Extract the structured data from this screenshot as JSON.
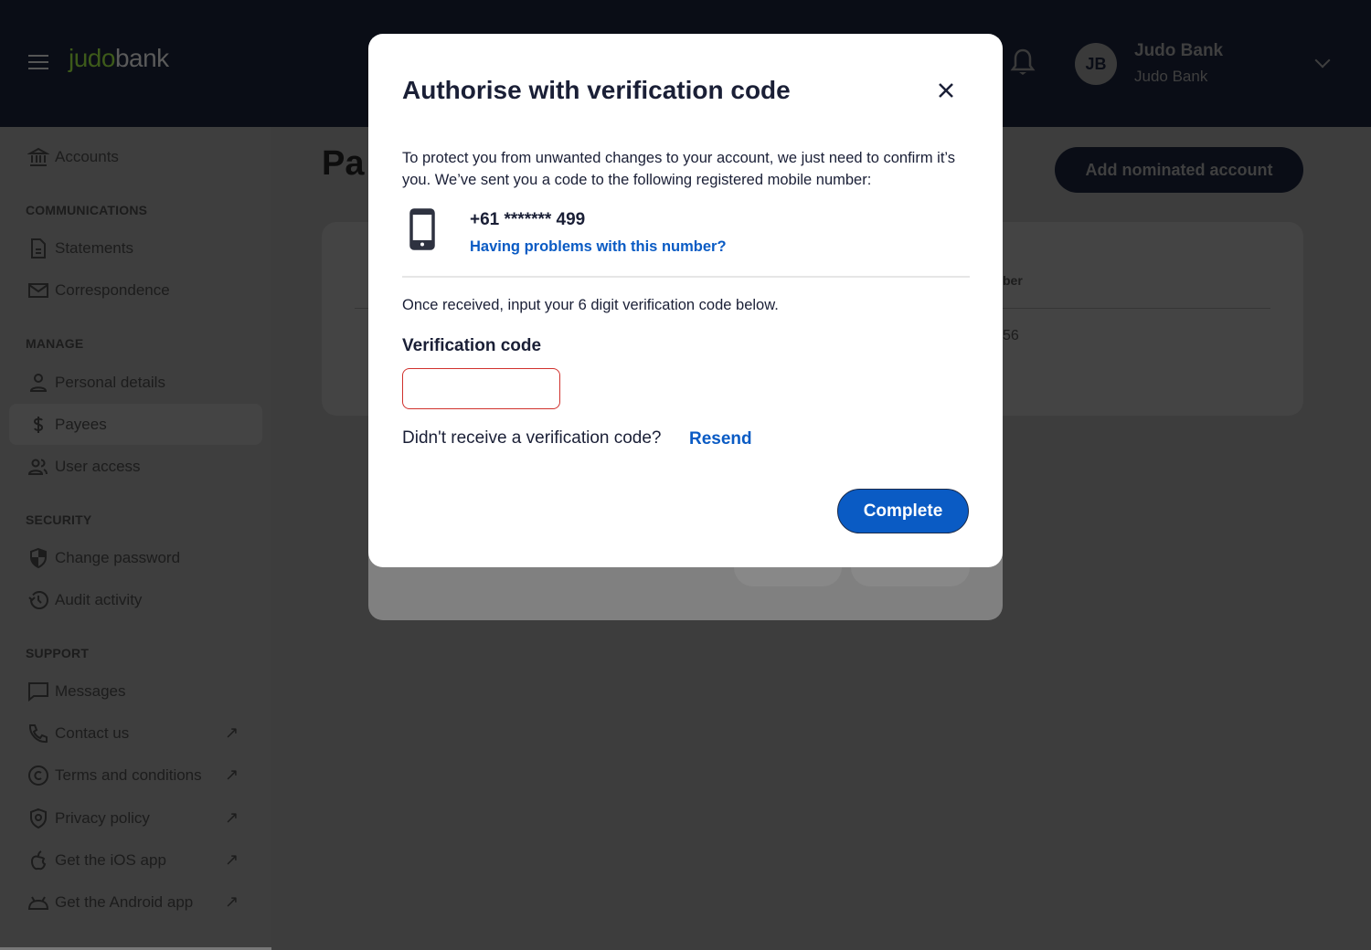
{
  "header": {
    "logo_part1": "judo",
    "logo_part2": "bank",
    "user_name": "Judo Bank",
    "user_subtitle": "Judo Bank",
    "avatar_initials": "JB"
  },
  "sidebar": {
    "accounts": "Accounts",
    "sections": {
      "communications": "COMMUNICATIONS",
      "manage": "MANAGE",
      "security": "SECURITY",
      "support": "SUPPORT"
    },
    "items": {
      "statements": "Statements",
      "correspondence": "Correspondence",
      "personal_details": "Personal details",
      "payees": "Payees",
      "user_access": "User access",
      "change_password": "Change password",
      "audit_activity": "Audit activity",
      "messages": "Messages",
      "contact_us": "Contact us",
      "terms": "Terms and conditions",
      "privacy": "Privacy policy",
      "ios_app": "Get the iOS app",
      "android_app": "Get the Android app"
    },
    "external_arrow": "↗",
    "active_item": "Payees"
  },
  "main": {
    "title_partial": "Pa",
    "add_button": "Add nominated account",
    "column_header_partial": "ber",
    "cell_partial": "56"
  },
  "modal": {
    "title": "Authorise with verification code",
    "description": "To protect you from unwanted changes to your account, we just need to confirm it’s you. We’ve sent you a code to the following registered mobile number:",
    "phone_number": "+61 ******* 499",
    "problem_link": "Having problems with this number?",
    "instruction": "Once received, input your 6 digit verification code below.",
    "code_label": "Verification code",
    "code_value": "",
    "resend_prompt": "Didn't receive a verification code?",
    "resend_link": "Resend",
    "complete_button": "Complete"
  },
  "colors": {
    "accent": "#0a5bc4",
    "header_bg": "#0a0d16",
    "error_border": "#d0312d",
    "brand_green": "#6ab023"
  }
}
